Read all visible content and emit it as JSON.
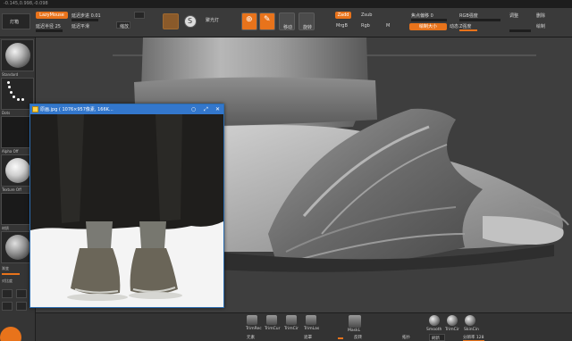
{
  "status": {
    "coords": "-0.145,0.998,-0.098"
  },
  "toolbar": {
    "menu_button": "灯箱",
    "lazymouse": "LazyMouse",
    "lazy_step": "延迟步进 0.01",
    "lazy_radius": "延迟半径 25",
    "lazy_smooth": "延迟平滑",
    "scaled_label": "缩放",
    "fusion_label": "拼合",
    "spotlight_label": "聚光灯",
    "move_label": "移动",
    "rotate_label": "旋转",
    "zadd": "Zadd",
    "zsub": "Zsub",
    "mrgb": "MrgB",
    "rgb": "Rgb",
    "m": "M",
    "z": "Z",
    "focal_label": "焦点偏移 0",
    "draw_size_label": "绘制大小",
    "backface_label": "背面遮罩",
    "dynamic_label": "动态",
    "soft_label": "动态",
    "rgb_intensity": "RGB强度",
    "z_intensity": "Z强度",
    "right_a": "调整",
    "right_b": "删除",
    "right_c": "绘制"
  },
  "left_panel": {
    "labels": [
      "Standard",
      "Dots",
      "Alpha Off",
      "材质球",
      "Texture Off",
      "材质",
      "背景色",
      "渐变色",
      "颜色"
    ],
    "bottom_a": "渐变",
    "bottom_b": "对比度"
  },
  "image_window": {
    "title": "原画.jpg ( 1076×957像素, 166K...",
    "buttons": [
      "○",
      "⤢",
      "✕"
    ]
  },
  "bottom_bar": {
    "brushes": [
      "TrimRec",
      "TrimCur",
      "TrimCir",
      "TrimLas"
    ],
    "mask_label": "MaskL",
    "smooth_brushes": [
      "Smooth",
      "TrimCir",
      "SkinCin"
    ],
    "label_a": "元素",
    "label_b": "遮罩",
    "label_c": "反转",
    "label_d": "拓扑",
    "label_e": "刷新",
    "value": "分辨率 128"
  },
  "colors": {
    "accent": "#e8731b",
    "window_title": "#3377cc"
  }
}
